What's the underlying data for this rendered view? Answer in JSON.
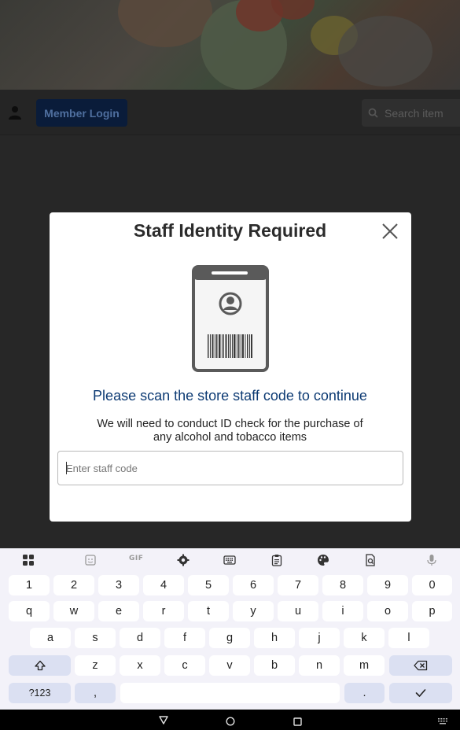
{
  "header": {
    "member_login_label": "Member Login",
    "search_placeholder": "Search item"
  },
  "modal": {
    "title": "Staff Identity Required",
    "scan_heading": "Please scan the store staff code to continue",
    "subtext": "We will need to conduct ID check for the purchase of any alcohol and tobacco items",
    "input_placeholder": "Enter staff code",
    "input_value": ""
  },
  "keyboard": {
    "toolbar": [
      "apps-icon",
      "sticker-icon",
      "gif-icon",
      "settings-icon",
      "keyboard-icon",
      "clipboard-icon",
      "palette-icon",
      "document-scan-icon",
      "mic-icon"
    ],
    "gif_label": "GIF",
    "row_numbers": [
      "1",
      "2",
      "3",
      "4",
      "5",
      "6",
      "7",
      "8",
      "9",
      "0"
    ],
    "row1": [
      "q",
      "w",
      "e",
      "r",
      "t",
      "y",
      "u",
      "i",
      "o",
      "p"
    ],
    "row2": [
      "a",
      "s",
      "d",
      "f",
      "g",
      "h",
      "j",
      "k",
      "l"
    ],
    "row3": [
      "z",
      "x",
      "c",
      "v",
      "b",
      "n",
      "m"
    ],
    "symbols_label": "?123",
    "comma_label": ",",
    "period_label": "."
  },
  "colors": {
    "accent_navy": "#0c3a73",
    "member_login_bg": "#0a1c3a",
    "keyboard_bg": "#f3f2f9",
    "fn_key_bg": "#dbe0f2"
  }
}
